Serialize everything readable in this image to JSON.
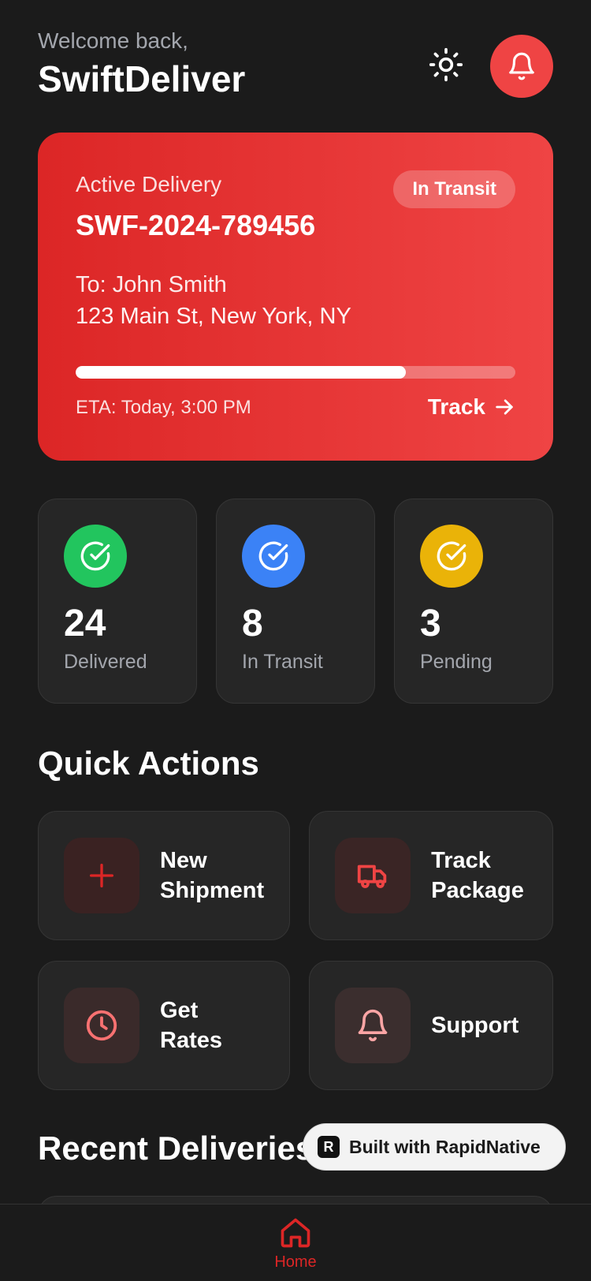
{
  "header": {
    "welcome": "Welcome back,",
    "title": "SwiftDeliver",
    "theme_icon": "sun-icon",
    "notification_icon": "bell-icon"
  },
  "active_delivery": {
    "label": "Active Delivery",
    "status": "In Transit",
    "tracking_id": "SWF-2024-789456",
    "recipient": "To: John Smith",
    "address": "123 Main St, New York, NY",
    "progress_fraction": 0.75,
    "eta": "ETA: Today, 3:00 PM",
    "track_label": "Track"
  },
  "stats": [
    {
      "value": "24",
      "label": "Delivered",
      "color": "#22c55e",
      "icon": "check-circle-icon"
    },
    {
      "value": "8",
      "label": "In Transit",
      "color": "#3b82f6",
      "icon": "check-circle-icon"
    },
    {
      "value": "3",
      "label": "Pending",
      "color": "#eab308",
      "icon": "check-circle-icon"
    }
  ],
  "quick_actions": {
    "title": "Quick Actions",
    "items": [
      {
        "label": "New\nShipment",
        "icon": "plus-icon"
      },
      {
        "label": "Track\nPackage",
        "icon": "truck-icon"
      },
      {
        "label": "Get\nRates",
        "icon": "clock-icon"
      },
      {
        "label": "Support",
        "icon": "bell-icon"
      }
    ]
  },
  "recent": {
    "title": "Recent Deliveries"
  },
  "built_badge": {
    "logo": "R",
    "text": "Built with RapidNative"
  },
  "nav": {
    "home_label": "Home",
    "home_icon": "home-icon"
  },
  "colors": {
    "accent": "#dc2626",
    "background": "#1b1b1b",
    "card": "#262626"
  }
}
